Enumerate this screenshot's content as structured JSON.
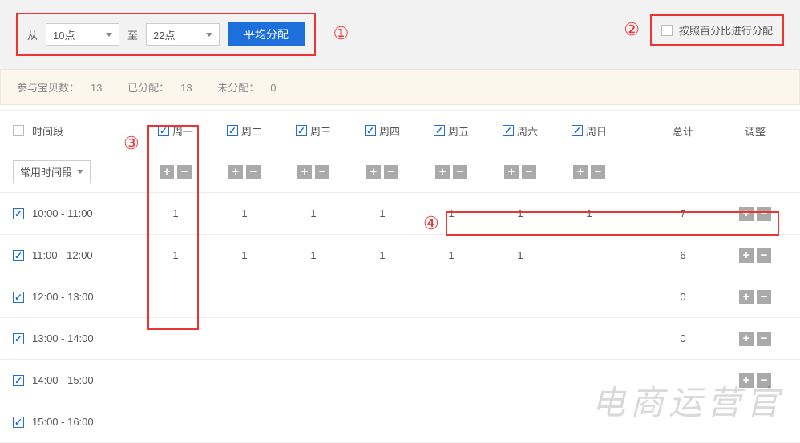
{
  "toolbar": {
    "from_label": "从",
    "from_value": "10点",
    "to_label": "至",
    "to_value": "22点",
    "distribute_button": "平均分配",
    "percentage_label": "按照百分比进行分配",
    "percentage_checked": false
  },
  "annotations": {
    "a1": "①",
    "a2": "②",
    "a3": "③",
    "a4": "④"
  },
  "status": {
    "items_label": "参与宝贝数：",
    "items_value": "13",
    "assigned_label": "已分配：",
    "assigned_value": "13",
    "unassigned_label": "未分配：",
    "unassigned_value": "0"
  },
  "table": {
    "time_header": "时间段",
    "common_slots_label": "常用时间段",
    "total_header": "总计",
    "adjust_header": "调整",
    "days": [
      "周一",
      "周二",
      "周三",
      "周四",
      "周五",
      "周六",
      "周日"
    ],
    "days_checked": [
      true,
      true,
      true,
      true,
      true,
      true,
      true
    ],
    "rows": [
      {
        "label": "10:00 - 11:00",
        "checked": true,
        "values": [
          "1",
          "1",
          "1",
          "1",
          "1",
          "1",
          "1"
        ],
        "total": "7",
        "adjust": true
      },
      {
        "label": "11:00 - 12:00",
        "checked": true,
        "values": [
          "1",
          "1",
          "1",
          "1",
          "1",
          "1",
          ""
        ],
        "total": "6",
        "adjust": true
      },
      {
        "label": "12:00 - 13:00",
        "checked": true,
        "values": [
          "",
          "",
          "",
          "",
          "",
          "",
          ""
        ],
        "total": "0",
        "adjust": true
      },
      {
        "label": "13:00 - 14:00",
        "checked": true,
        "values": [
          "",
          "",
          "",
          "",
          "",
          "",
          ""
        ],
        "total": "0",
        "adjust": true
      },
      {
        "label": "14:00 - 15:00",
        "checked": true,
        "values": [
          "",
          "",
          "",
          "",
          "",
          "",
          ""
        ],
        "total": "",
        "adjust": true
      },
      {
        "label": "15:00 - 16:00",
        "checked": true,
        "values": [
          "",
          "",
          "",
          "",
          "",
          "",
          ""
        ],
        "total": "",
        "adjust": false
      }
    ]
  },
  "watermark": "电商运营官"
}
